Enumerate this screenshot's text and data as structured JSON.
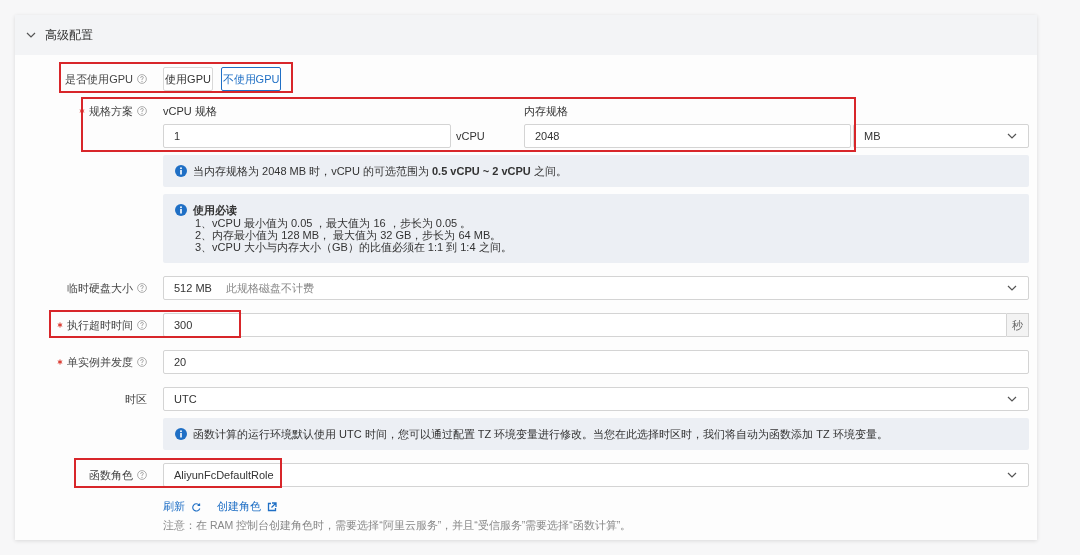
{
  "section": {
    "title": "高级配置",
    "expanded": true
  },
  "rows": [
    {
      "kind": "segmented",
      "label": "是否使用GPU",
      "required": false,
      "help": true,
      "highlighted": true,
      "options": [
        {
          "label": "使用GPU",
          "selected": false
        },
        {
          "label": "不使用GPU",
          "selected": true
        }
      ]
    },
    {
      "kind": "spec",
      "label": "规格方案",
      "required": true,
      "help": true,
      "highlighted": true,
      "cpu": {
        "caption": "vCPU 规格",
        "value": "1",
        "unit": "vCPU"
      },
      "memory": {
        "caption": "内存规格",
        "value": "2048",
        "unit": "MB"
      }
    },
    {
      "kind": "info",
      "text": "当内存规格为 2048 MB 时，vCPU 的可选范围为 **0.5 vCPU ~ 2 vCPU** 之间。"
    },
    {
      "kind": "notice",
      "title": "使用必读",
      "lines": [
        "1、vCPU 最小值为 0.05 ，最大值为 16 ，步长为 0.05 。",
        "2、内存最小值为 128 MB， 最大值为 32 GB，步长为 64 MB。",
        "3、vCPU 大小与内存大小（GB）的比值必须在 1:1 到 1:4 之间。"
      ]
    },
    {
      "kind": "select",
      "label": "临时硬盘大小",
      "required": false,
      "help": true,
      "highlighted": false,
      "value": "512 MB",
      "hint": "此规格磁盘不计费"
    },
    {
      "kind": "input",
      "label": "执行超时时间",
      "required": true,
      "help": true,
      "highlighted": true,
      "value": "300",
      "unit": "秒"
    },
    {
      "kind": "input",
      "label": "单实例并发度",
      "required": true,
      "help": true,
      "highlighted": false,
      "value": "20"
    },
    {
      "kind": "select",
      "label": "时区",
      "required": false,
      "help": false,
      "highlighted": false,
      "value": "UTC"
    },
    {
      "kind": "info",
      "text": "函数计算的运行环境默认使用 UTC 时间，您可以通过配置 TZ 环境变量进行修改。当您在此选择时区时，我们将自动为函数添加 TZ 环境变量。"
    },
    {
      "kind": "select",
      "label": "函数角色",
      "required": false,
      "help": true,
      "highlighted": true,
      "value": "AliyunFcDefaultRole"
    },
    {
      "kind": "links",
      "links": [
        {
          "label": "刷新",
          "kind": "refresh"
        },
        {
          "label": "创建角色",
          "kind": "external"
        }
      ]
    },
    {
      "kind": "note",
      "text": "注意：在 RAM 控制台创建角色时，需要选择“阿里云服务”，并且“受信服务”需要选择“函数计算”。"
    }
  ]
}
